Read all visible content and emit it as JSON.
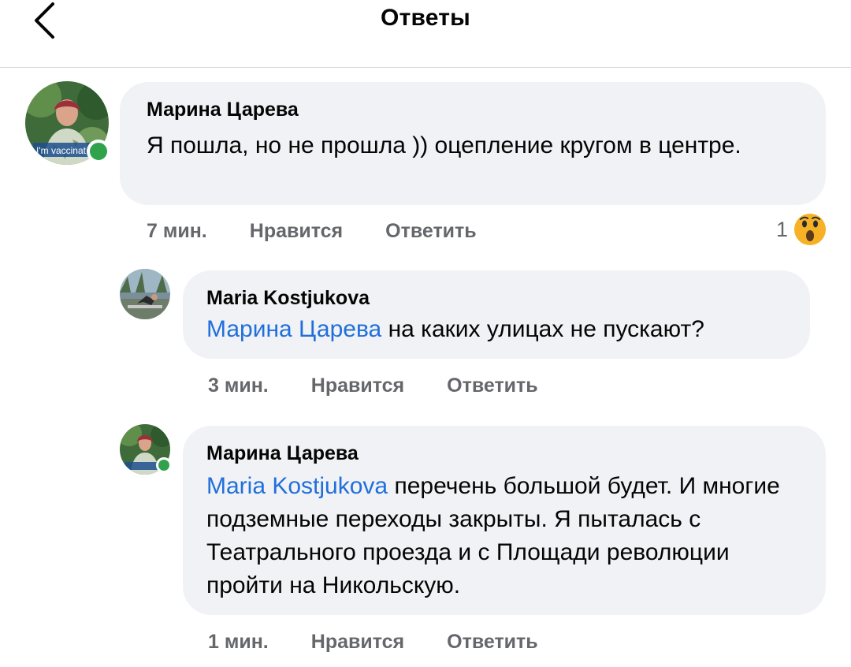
{
  "header": {
    "title": "Ответы"
  },
  "comments": [
    {
      "author": "Марина Царева",
      "mention": "",
      "text": "Я пошла, но не прошла )) оцепление кругом в центре.",
      "time": "7 мин.",
      "like_label": "Нравится",
      "reply_label": "Ответить",
      "reaction_count": "1",
      "reaction_icon": "wow-emoji-icon",
      "online": true
    },
    {
      "author": "Maria Kostjukova",
      "mention": "Марина Царева",
      "text": "на каких улицах не пускают?",
      "time": "3 мин.",
      "like_label": "Нравится",
      "reply_label": "Ответить",
      "online": false
    },
    {
      "author": "Марина Царева",
      "mention": "Maria Kostjukova",
      "text": "перечень большой будет. И многие подземные переходы закрыты. Я пыталась с Театрального проезда и с Площади революции пройти на Никольскую.",
      "time": "1 мин.",
      "like_label": "Нравится",
      "reply_label": "Ответить",
      "online": true
    }
  ],
  "avatar_badge_text": "I'm vaccinat",
  "colors": {
    "bubble_bg": "#f0f2f5",
    "mention": "#216fdb",
    "meta_text": "#65676b",
    "online": "#31a24c"
  }
}
